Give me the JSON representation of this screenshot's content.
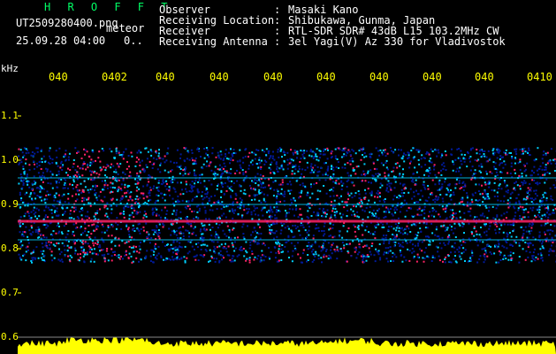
{
  "header": {
    "title": "H R O F F T",
    "filename": "UT2509280400.png",
    "mode": "meteor",
    "timestamp": "25.09.28 04:00",
    "counter": "0..",
    "observer_label": "Observer",
    "observer_value": "Masaki Kano",
    "location_label": "Receiving Location",
    "location_value": "Shibukawa, Gunma, Japan",
    "receiver_label": "Receiver",
    "receiver_value": "RTL-SDR SDR# 43dB L15 103.2MHz CW",
    "antenna_label": "Receiving Antenna",
    "antenna_value": "3el Yagi(V) Az 330 for Vladivostok",
    "separator": ":"
  },
  "axes": {
    "y_unit": "kHz",
    "y_ticks": [
      "1.1",
      "1.0",
      "0.9",
      "0.8",
      "0.7",
      "0.6"
    ],
    "x_ticks": [
      "040",
      "0402",
      "040",
      "040",
      "040",
      "040",
      "040",
      "040",
      "040",
      "0410"
    ]
  },
  "colors": {
    "text": "#ffffff",
    "title": "#00ff66",
    "axis": "#ffff00",
    "background": "#000000",
    "signal_low": "#001a99",
    "signal_mid": "#00d0ff",
    "signal_high": "#ff2266",
    "amplitude": "#ffff00"
  },
  "spectrogram": {
    "signal_band_khz": [
      0.77,
      1.03
    ],
    "carrier_khz": 0.862,
    "intense_bursts": [
      {
        "time_fraction_start": 0.09,
        "time_fraction_end": 0.24,
        "intensity": 1.0
      },
      {
        "time_fraction_start": 0.58,
        "time_fraction_end": 0.66,
        "intensity": 0.75
      }
    ]
  }
}
